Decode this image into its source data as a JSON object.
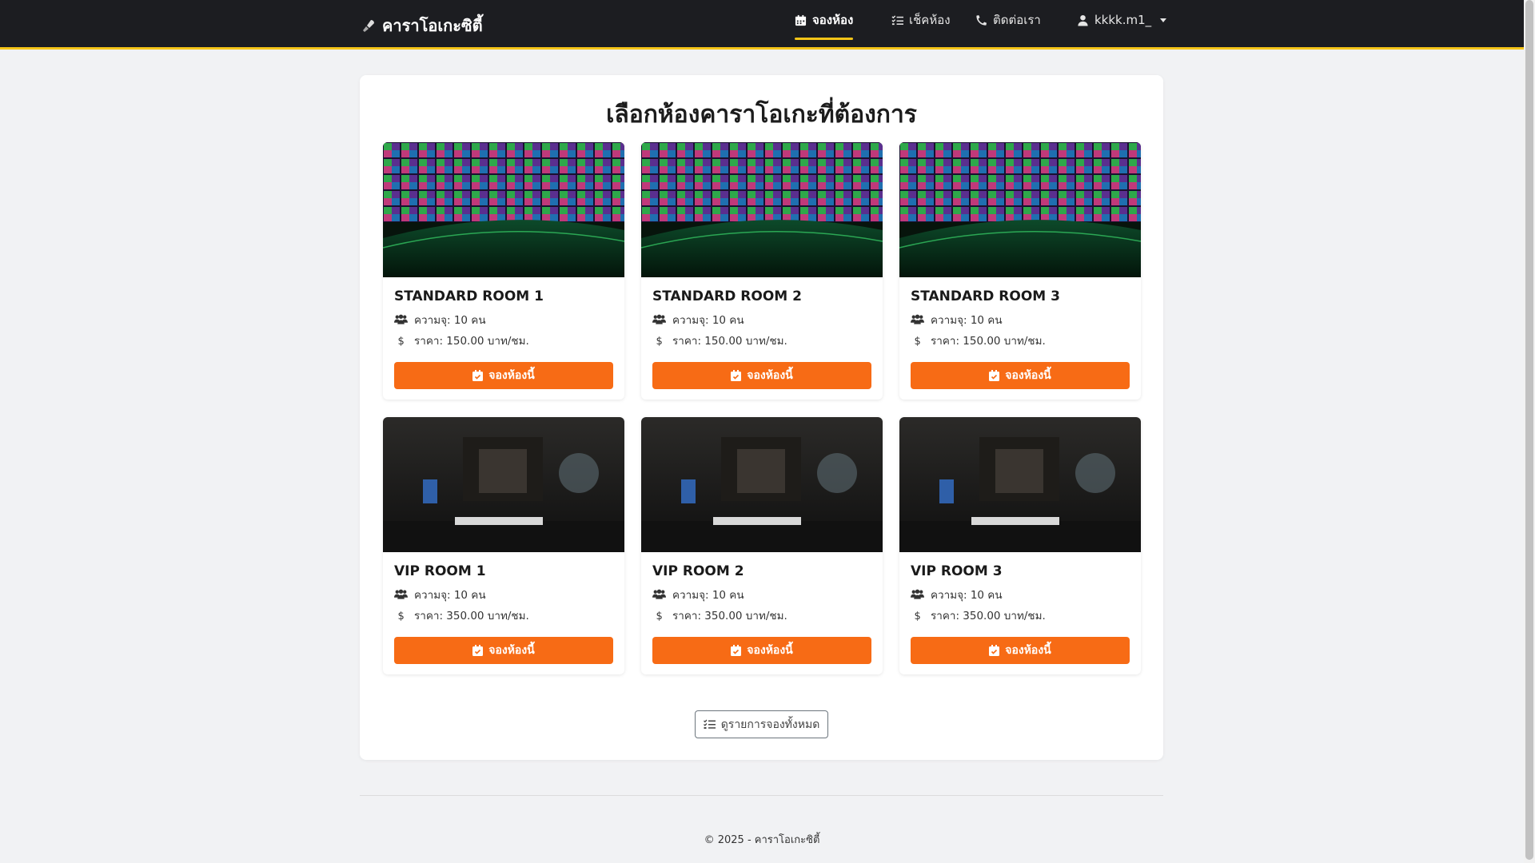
{
  "colors": {
    "navbar_bg": "#1c1d21",
    "accent_yellow": "#f5c518",
    "book_button": "#f76b15",
    "page_bg": "#f1f2f4"
  },
  "navbar": {
    "brand_icon": "microphone-icon",
    "brand": "คาราโอเกะซิตี้",
    "items": [
      {
        "icon": "calendar-icon",
        "label": "จองห้อง",
        "active": true
      },
      {
        "icon": "checklist-icon",
        "label": "เช็คห้อง",
        "active": false
      },
      {
        "icon": "phone-icon",
        "label": "ติดต่อเรา",
        "active": false
      }
    ],
    "user": {
      "icon": "user-icon",
      "label": "kkkk.m1_"
    }
  },
  "main": {
    "title": "เลือกห้องคาราโอเกะที่ต้องการ",
    "rooms": [
      {
        "name": "STANDARD ROOM 1",
        "capacity": "ความจุ: 10 คน",
        "price": "ราคา: 150.00 บาท/ชม.",
        "button": "จองห้องนี้",
        "image": "standard-room-photo"
      },
      {
        "name": "STANDARD ROOM 2",
        "capacity": "ความจุ: 10 คน",
        "price": "ราคา: 150.00 บาท/ชม.",
        "button": "จองห้องนี้",
        "image": "standard-room-photo"
      },
      {
        "name": "STANDARD ROOM 3",
        "capacity": "ความจุ: 10 คน",
        "price": "ราคา: 150.00 บาท/ชม.",
        "button": "จองห้องนี้",
        "image": "standard-room-photo"
      },
      {
        "name": "VIP ROOM 1",
        "capacity": "ความจุ: 10 คน",
        "price": "ราคา: 350.00 บาท/ชม.",
        "button": "จองห้องนี้",
        "image": "vip-room-photo"
      },
      {
        "name": "VIP ROOM 2",
        "capacity": "ความจุ: 10 คน",
        "price": "ราคา: 350.00 บาท/ชม.",
        "button": "จองห้องนี้",
        "image": "vip-room-photo"
      },
      {
        "name": "VIP ROOM 3",
        "capacity": "ความจุ: 10 คน",
        "price": "ราคา: 350.00 บาท/ชม.",
        "button": "จองห้องนี้",
        "image": "vip-room-photo"
      }
    ],
    "view_all_button": "ดูรายการจองทั้งหมด"
  },
  "footer": {
    "text": "© 2025 - คาราโอเกะซิตี้"
  }
}
